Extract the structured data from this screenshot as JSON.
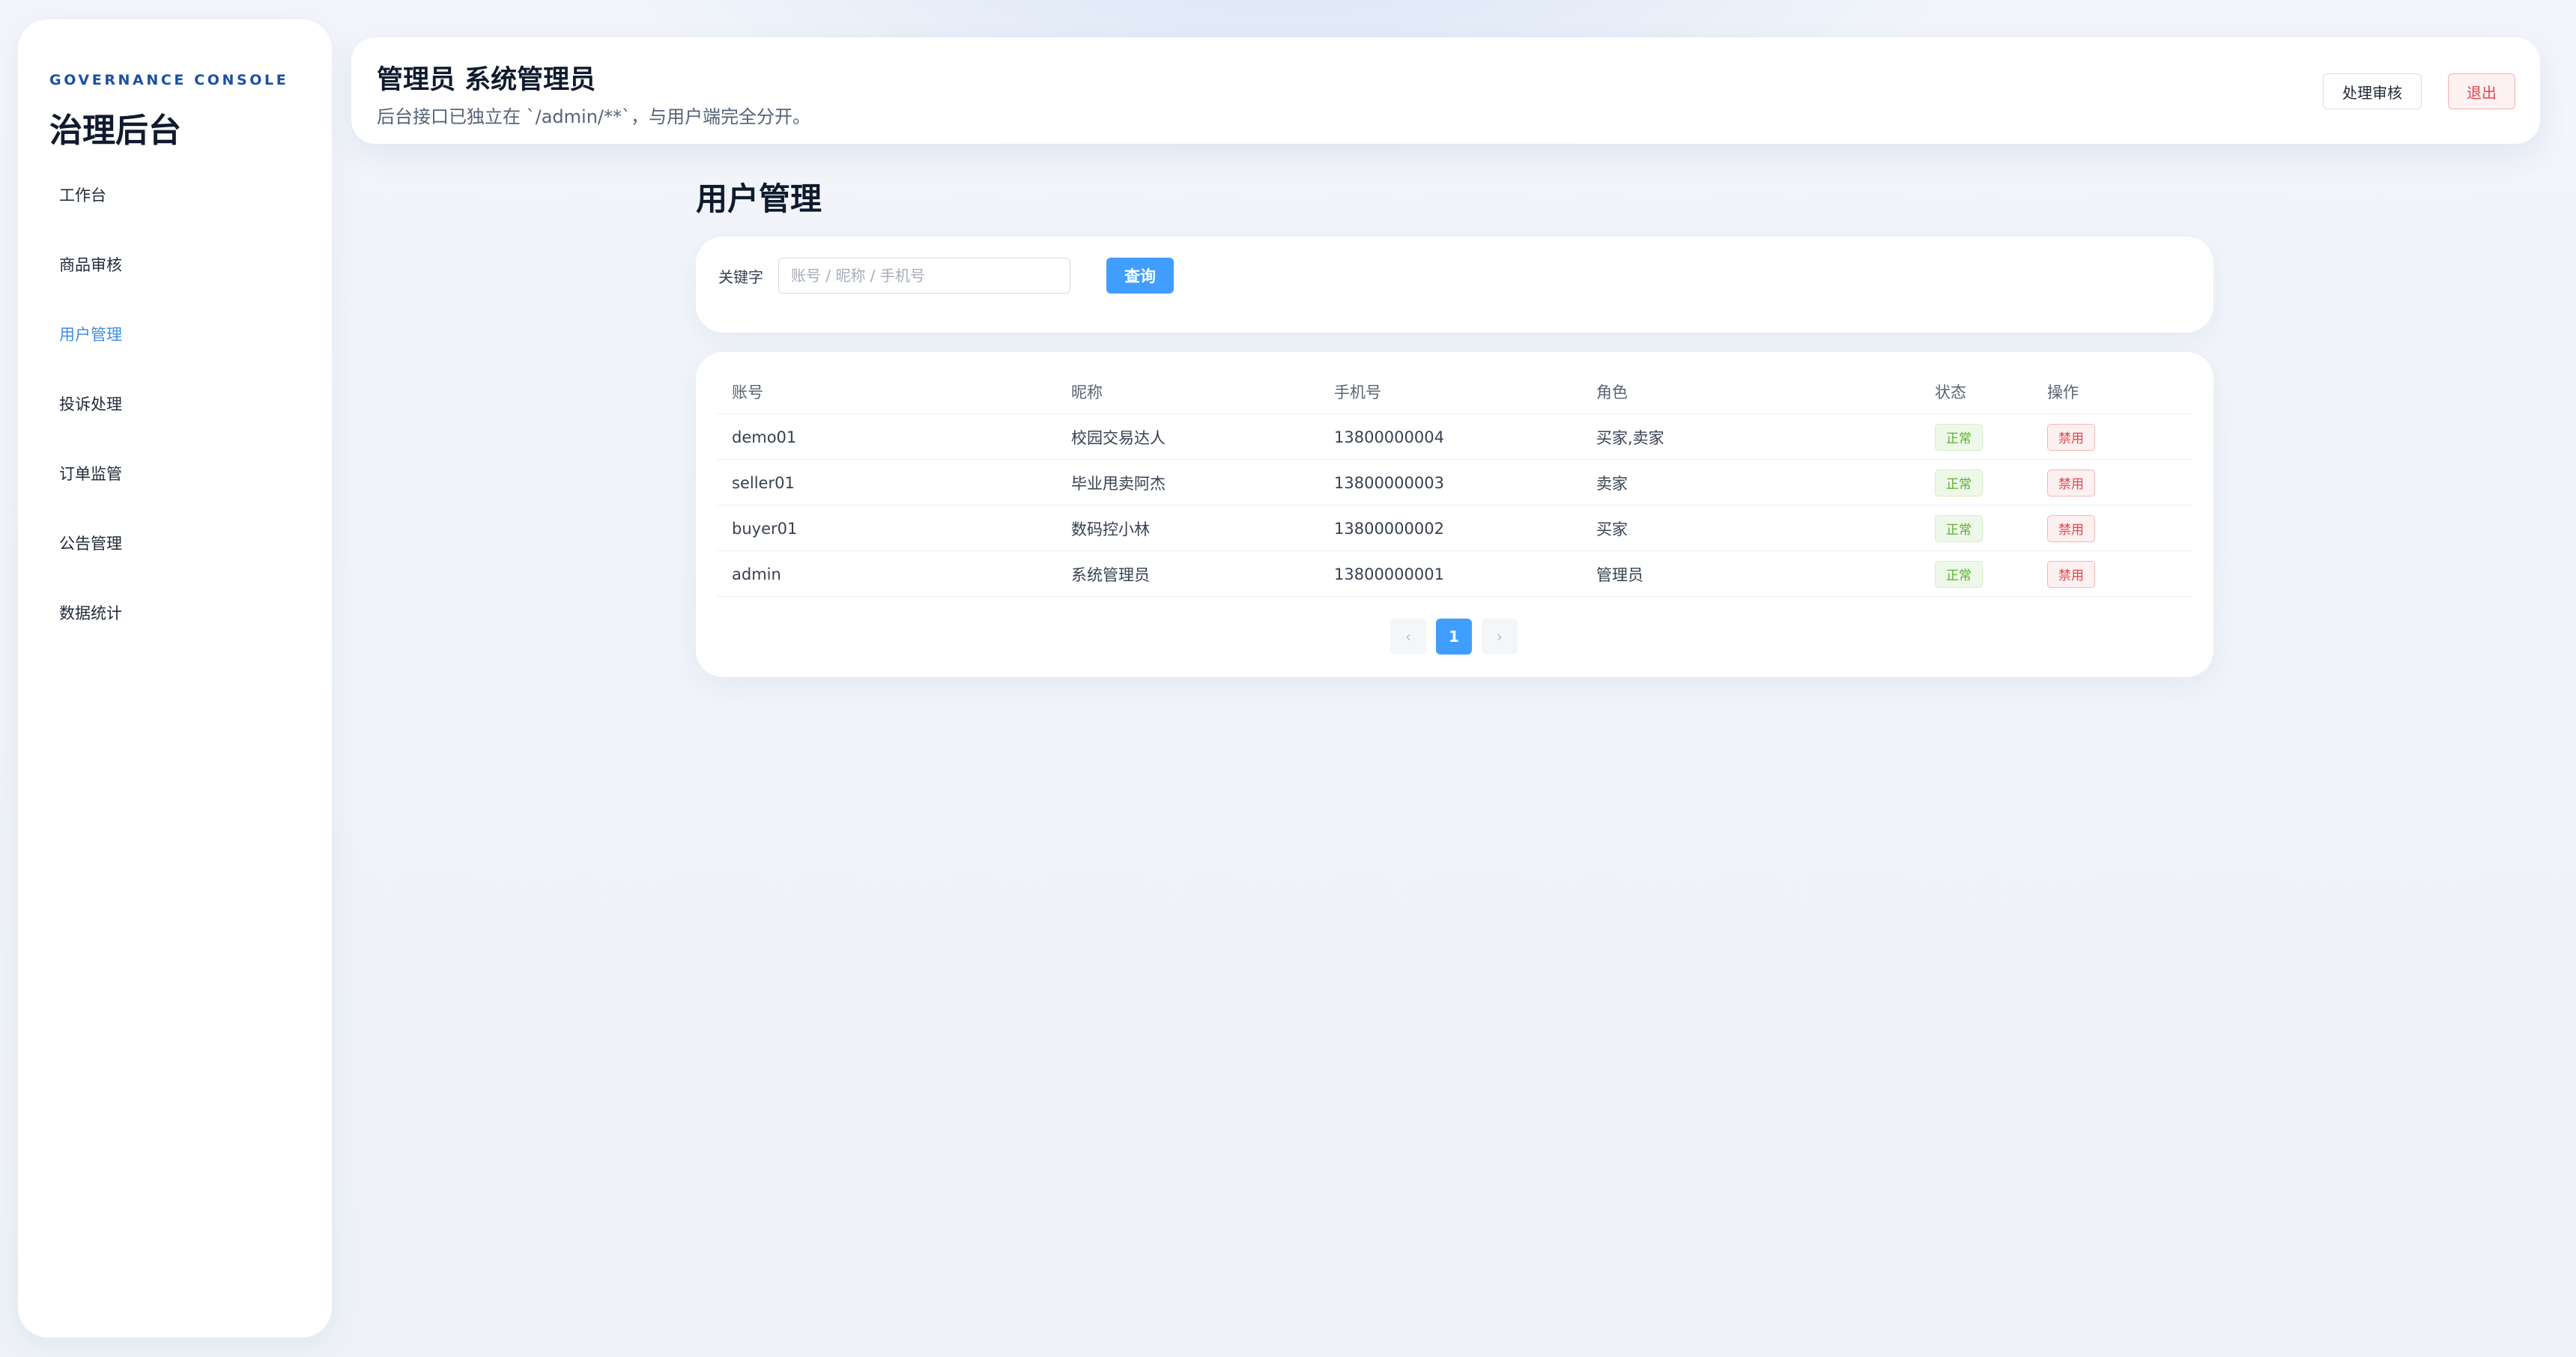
{
  "sidebar": {
    "kicker": "GOVERNANCE CONSOLE",
    "title": "治理后台",
    "items": [
      {
        "label": "工作台"
      },
      {
        "label": "商品审核"
      },
      {
        "label": "用户管理"
      },
      {
        "label": "投诉处理"
      },
      {
        "label": "订单监管"
      },
      {
        "label": "公告管理"
      },
      {
        "label": "数据统计"
      }
    ]
  },
  "topbar": {
    "title": "管理员 系统管理员",
    "subtitle": "后台接口已独立在 `/admin/**`，与用户端完全分开。",
    "review_label": "处理审核",
    "logout_label": "退出"
  },
  "page": {
    "title": "用户管理"
  },
  "search": {
    "label": "关键字",
    "placeholder": "账号 / 昵称 / 手机号",
    "value": "",
    "button": "查询"
  },
  "table": {
    "headers": [
      "账号",
      "昵称",
      "手机号",
      "角色",
      "状态",
      "操作"
    ],
    "rows": [
      {
        "account": "demo01",
        "nickname": "校园交易达人",
        "phone": "13800000004",
        "role": "买家,卖家",
        "status": "正常",
        "action": "禁用"
      },
      {
        "account": "seller01",
        "nickname": "毕业甩卖阿杰",
        "phone": "13800000003",
        "role": "卖家",
        "status": "正常",
        "action": "禁用"
      },
      {
        "account": "buyer01",
        "nickname": "数码控小林",
        "phone": "13800000002",
        "role": "买家",
        "status": "正常",
        "action": "禁用"
      },
      {
        "account": "admin",
        "nickname": "系统管理员",
        "phone": "13800000001",
        "role": "管理员",
        "status": "正常",
        "action": "禁用"
      }
    ]
  },
  "pagination": {
    "prev": "‹",
    "current": "1",
    "next": "›"
  },
  "colors": {
    "accent": "#409eff",
    "danger": "#e0484c",
    "success": "#5ab030",
    "brand": "#1e4fa3"
  }
}
